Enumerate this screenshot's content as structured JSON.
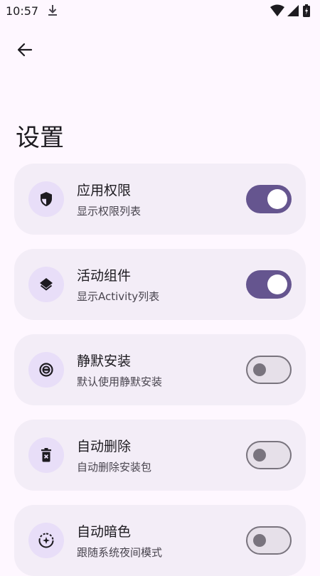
{
  "status_bar": {
    "time": "10:57"
  },
  "header": {
    "title": "设置"
  },
  "settings": [
    {
      "title": "应用权限",
      "subtitle": "显示权限列表",
      "icon": "shield-icon",
      "enabled": true
    },
    {
      "title": "活动组件",
      "subtitle": "显示Activity列表",
      "icon": "layers-icon",
      "enabled": true
    },
    {
      "title": "静默安装",
      "subtitle": "默认使用静默安装",
      "icon": "do-not-disturb-icon",
      "enabled": false
    },
    {
      "title": "自动删除",
      "subtitle": "自动删除安装包",
      "icon": "delete-icon",
      "enabled": false
    },
    {
      "title": "自动暗色",
      "subtitle": "跟随系统夜间模式",
      "icon": "auto-dark-mode-icon",
      "enabled": false
    }
  ],
  "colors": {
    "background": "#FEF7FF",
    "card": "#F3EDF7",
    "icon_circle": "#E8DEF8",
    "switch_on": "#65558F",
    "switch_off_track": "#E6E0E9",
    "switch_off_outline": "#79747E"
  }
}
